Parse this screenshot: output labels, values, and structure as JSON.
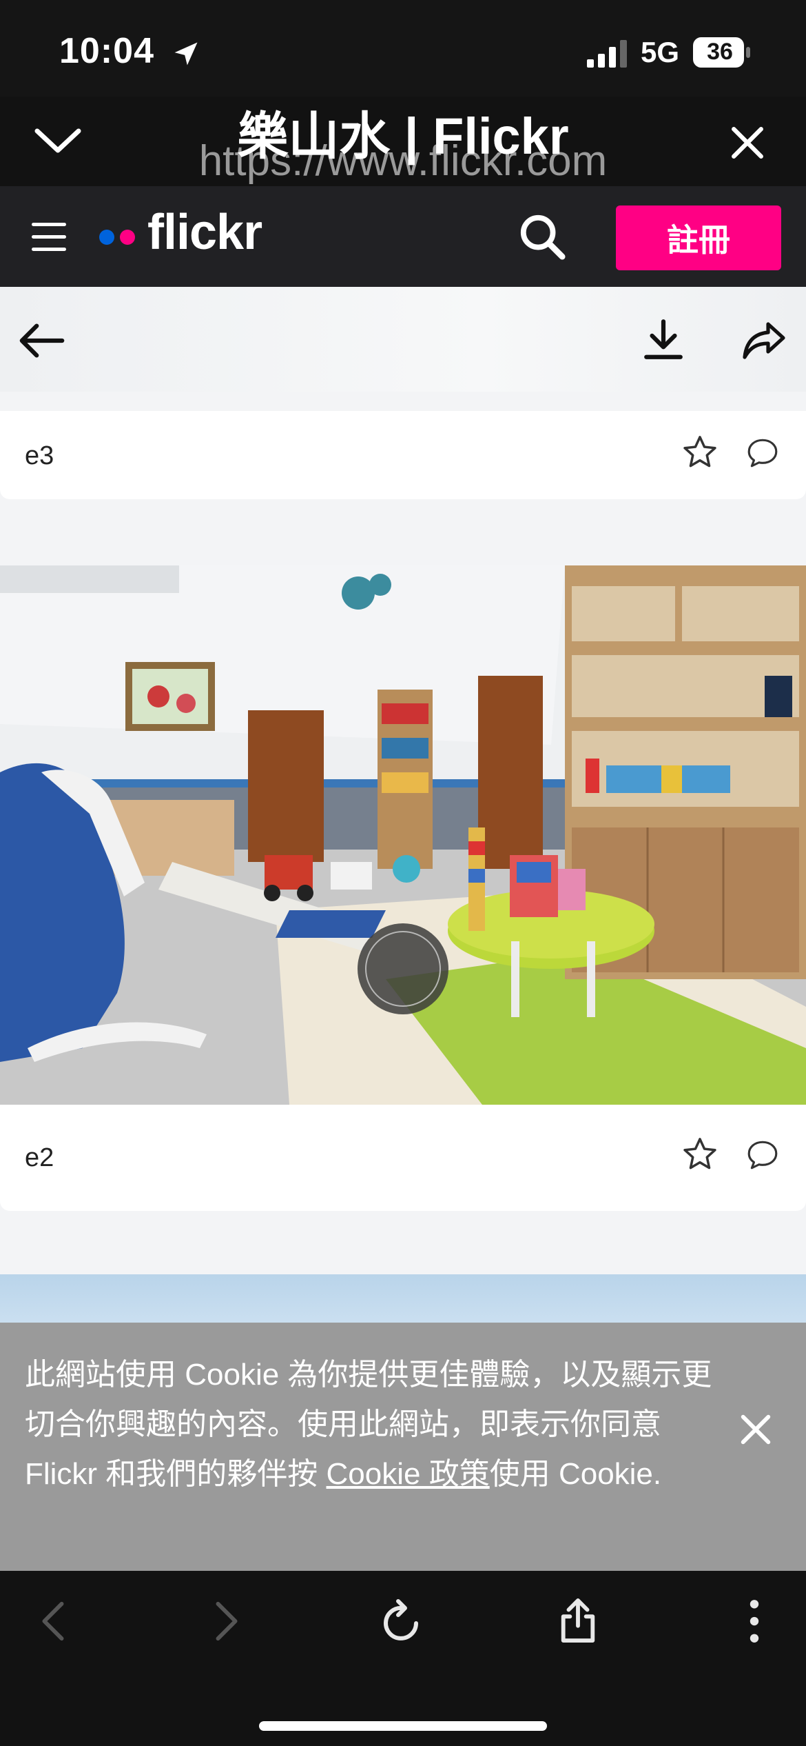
{
  "status_bar": {
    "time": "10:04",
    "network": "5G",
    "battery": "36"
  },
  "browser": {
    "page_title": "樂山水 | Flickr",
    "url": "https://www.flickr.com"
  },
  "flickr_nav": {
    "logo_text": "flickr",
    "signup_label": "註冊"
  },
  "photos": [
    {
      "title": "e3"
    },
    {
      "title": "e2"
    }
  ],
  "cookie_banner": {
    "text_before_link": "此網站使用 Cookie 為你提供更佳體驗，以及顯示更切合你興趣的內容。使用此網站，即表示你同意 Flickr 和我們的夥伴按 ",
    "link_text": "Cookie 政策",
    "text_after_link": "使用 Cookie."
  },
  "colors": {
    "brand_pink": "#ff0084",
    "brand_blue": "#0063dc",
    "nav_bg": "#212124"
  }
}
